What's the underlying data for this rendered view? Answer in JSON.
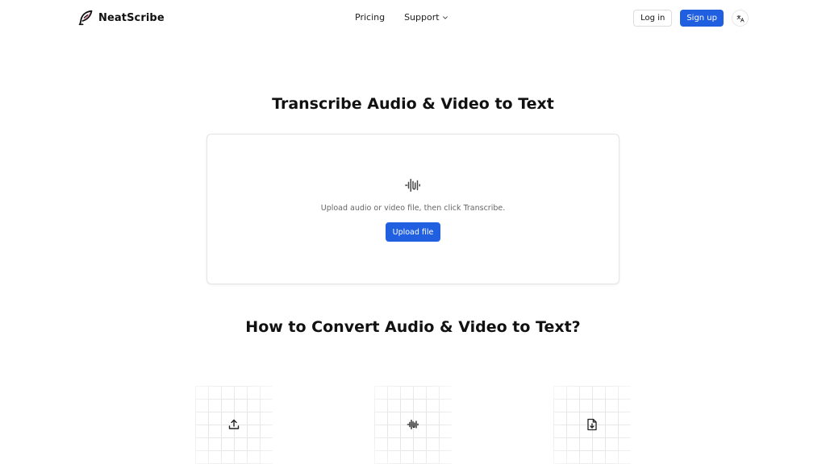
{
  "brand": {
    "name": "NeatScribe",
    "logo_icon": "quill-logo-icon",
    "accent_color": "#1f5fe0"
  },
  "nav": {
    "pricing": "Pricing",
    "support": "Support"
  },
  "actions": {
    "login": "Log in",
    "signup": "Sign up",
    "language_icon": "translate-icon"
  },
  "hero": {
    "title": "Transcribe Audio & Video to Text",
    "upload_hint": "Upload audio or video file, then click Transcribe.",
    "upload_button": "Upload file",
    "icon": "audio-wave-icon"
  },
  "how_to": {
    "title": "How to Convert Audio & Video to Text?",
    "steps": [
      {
        "icon": "upload-icon"
      },
      {
        "icon": "audio-wave-icon"
      },
      {
        "icon": "file-download-icon"
      }
    ]
  }
}
